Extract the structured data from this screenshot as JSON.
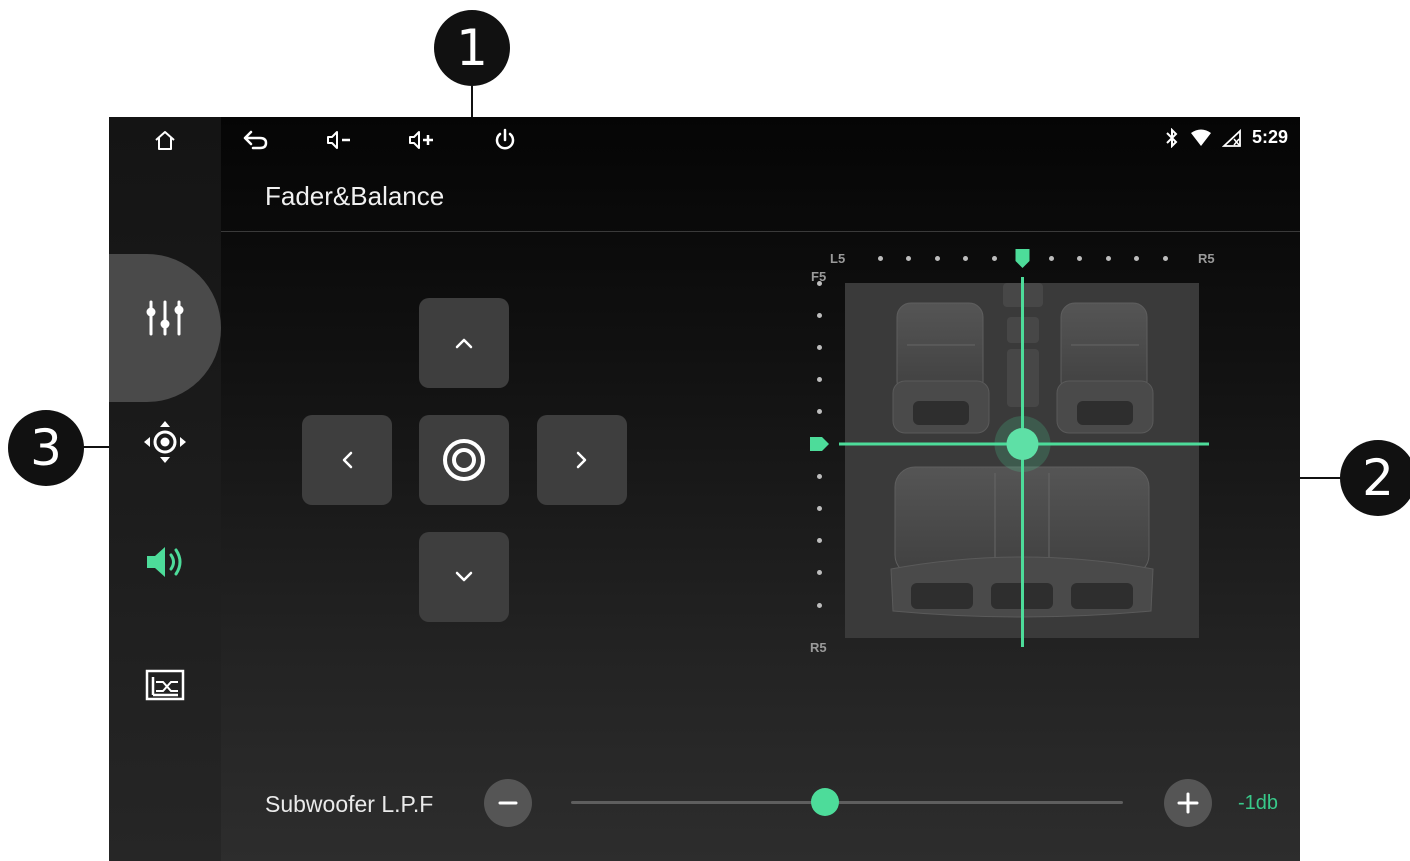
{
  "callouts": [
    "1",
    "2",
    "3"
  ],
  "topbar": {
    "icons": [
      "home-icon",
      "back-icon",
      "volume-down-icon",
      "volume-up-icon",
      "power-icon"
    ],
    "status_icons": [
      "bluetooth-icon",
      "wifi-icon",
      "signal-icon"
    ],
    "time": "5:29"
  },
  "sidebar": {
    "items": [
      {
        "icon": "equalizer-sliders-icon",
        "active": true
      },
      {
        "icon": "position-target-icon",
        "active": false
      },
      {
        "icon": "speaker-volume-icon",
        "active": false,
        "color": "#4ddc9a"
      },
      {
        "icon": "crossover-graph-icon",
        "active": false
      }
    ]
  },
  "page": {
    "title": "Fader&Balance"
  },
  "dpad": {
    "buttons": [
      "up-arrow",
      "left-arrow",
      "center-reset",
      "right-arrow",
      "down-arrow"
    ]
  },
  "balance": {
    "left_label": "L5",
    "right_label": "R5",
    "front_label": "F5",
    "rear_label": "R5",
    "horizontal_steps": 11,
    "vertical_steps": 11,
    "balance_position": 0,
    "fader_position": 0,
    "accent": "#4ddc9a"
  },
  "subwoofer": {
    "label": "Subwoofer L.P.F",
    "value": "-1db",
    "level": 0.46,
    "minus_icon": "minus-icon",
    "plus_icon": "plus-icon"
  }
}
